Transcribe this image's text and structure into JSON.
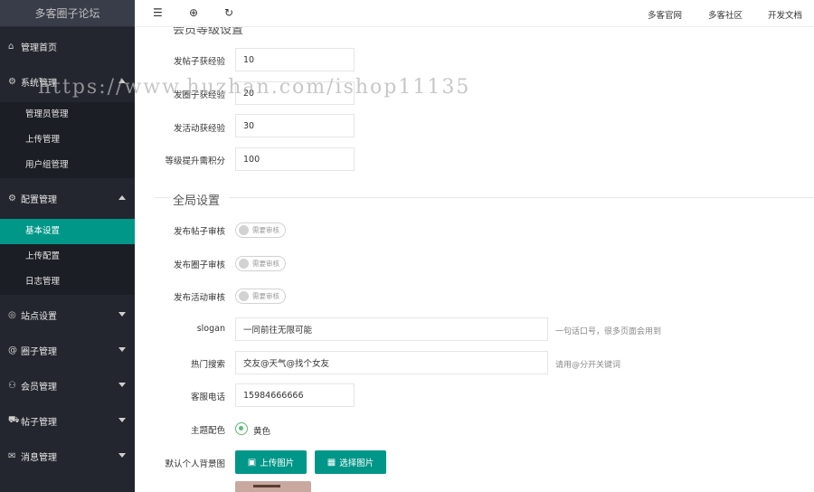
{
  "app": {
    "title": "多客圈子论坛"
  },
  "topbar": {
    "links": [
      "多客官网",
      "多客社区",
      "开发文档"
    ],
    "icons": [
      "collapse-menu-icon",
      "globe-icon",
      "refresh-icon"
    ]
  },
  "sidebar": {
    "items": [
      {
        "label": "管理首页",
        "icon": "home-icon"
      },
      {
        "label": "系统管理",
        "icon": "gear-icon"
      },
      {
        "label": "配置管理",
        "icon": "gear-icon"
      },
      {
        "label": "站点设置",
        "icon": "compass-icon"
      },
      {
        "label": "圈子管理",
        "icon": "at-icon"
      },
      {
        "label": "会员管理",
        "icon": "user-icon"
      },
      {
        "label": "帖子管理",
        "icon": "cart-icon"
      },
      {
        "label": "消息管理",
        "icon": "message-icon"
      }
    ],
    "system_sub": [
      "管理员管理",
      "上传管理",
      "用户组管理"
    ],
    "config_sub": [
      "基本设置",
      "上传配置",
      "日志管理"
    ]
  },
  "level_section": {
    "title": "会员等级设置",
    "fields": [
      {
        "label": "发帖子获经验",
        "value": "10"
      },
      {
        "label": "发圈子获经验",
        "value": "20"
      },
      {
        "label": "发活动获经验",
        "value": "30"
      },
      {
        "label": "等级提升需积分",
        "value": "100"
      }
    ]
  },
  "global_section": {
    "title": "全局设置",
    "switches": [
      {
        "label": "发布帖子审核",
        "text": "需要审核"
      },
      {
        "label": "发布圈子审核",
        "text": "需要审核"
      },
      {
        "label": "发布活动审核",
        "text": "需要审核"
      }
    ],
    "slogan": {
      "label": "slogan",
      "value": "一同前往无限可能",
      "hint": "一句话口号，很多页面会用到"
    },
    "hot_search": {
      "label": "热门搜索",
      "value": "交友@天气@找个女友",
      "hint": "请用@分开关键词"
    },
    "phone": {
      "label": "客服电话",
      "value": "15984666666"
    },
    "theme": {
      "label": "主题配色",
      "option": "黄色"
    },
    "background": {
      "label": "默认个人背景图",
      "upload_label": "上传图片",
      "select_label": "选择图片"
    }
  },
  "watermark": "https://www.huzhan.com/ishop11135",
  "colors": {
    "accent": "#009688",
    "sidebar_bg": "#23262e",
    "radio": "#5FB878"
  }
}
